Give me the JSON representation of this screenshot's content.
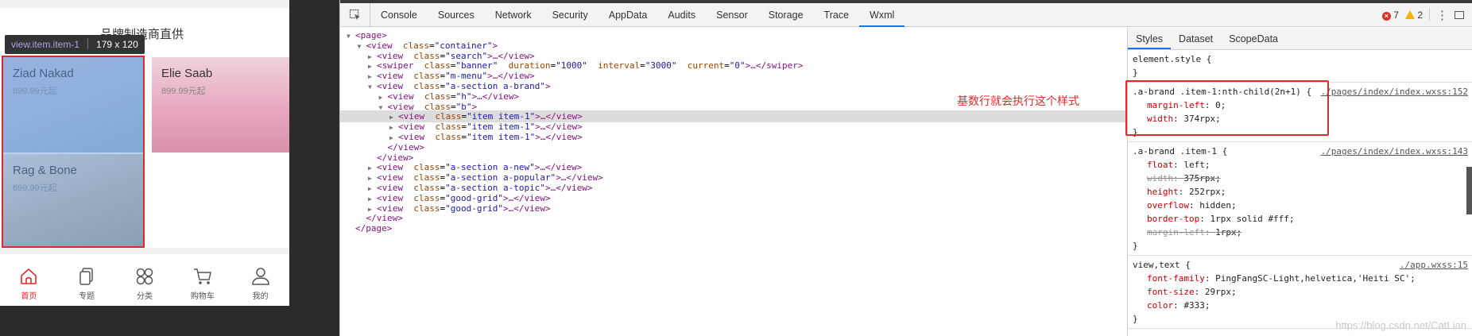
{
  "simulator": {
    "brand_title": "品牌制造商直供",
    "inspect_tooltip": {
      "selector": "view.item.item-1",
      "size": "179 x 120"
    },
    "items": [
      {
        "name": "Ziad Nakad",
        "price": "899.99元起"
      },
      {
        "name": "Elie Saab",
        "price": "899.99元起"
      },
      {
        "name": "Rag & Bone",
        "price": "899.99元起"
      }
    ],
    "tabbar": [
      {
        "label": "首页",
        "icon": "home-icon",
        "active": true
      },
      {
        "label": "专题",
        "icon": "topic-icon",
        "active": false
      },
      {
        "label": "分类",
        "icon": "category-icon",
        "active": false
      },
      {
        "label": "购物车",
        "icon": "cart-icon",
        "active": false
      },
      {
        "label": "我的",
        "icon": "user-icon",
        "active": false
      }
    ]
  },
  "devtools": {
    "tabs": [
      "Console",
      "Sources",
      "Network",
      "Security",
      "AppData",
      "Audits",
      "Sensor",
      "Storage",
      "Trace",
      "Wxml"
    ],
    "active_tab": "Wxml",
    "error_count": "7",
    "warning_count": "2",
    "tree": [
      {
        "indent": 0,
        "arrow": "▼",
        "open": "<page>",
        "attrs": [],
        "tail": ""
      },
      {
        "indent": 1,
        "arrow": "▼",
        "open": "<view",
        "attrs": [
          [
            "class",
            "\"container\""
          ]
        ],
        "tail": ">"
      },
      {
        "indent": 2,
        "arrow": "▶",
        "open": "<view",
        "attrs": [
          [
            "class",
            "\"search\""
          ]
        ],
        "tail": ">…</view>"
      },
      {
        "indent": 2,
        "arrow": "▶",
        "open": "<swiper",
        "attrs": [
          [
            "class",
            "\"banner\""
          ],
          [
            "duration",
            "\"1000\""
          ],
          [
            "interval",
            "\"3000\""
          ],
          [
            "current",
            "\"0\""
          ]
        ],
        "tail": ">…</swiper>"
      },
      {
        "indent": 2,
        "arrow": "▶",
        "open": "<view",
        "attrs": [
          [
            "class",
            "\"m-menu\""
          ]
        ],
        "tail": ">…</view>"
      },
      {
        "indent": 2,
        "arrow": "▼",
        "open": "<view",
        "attrs": [
          [
            "class",
            "\"a-section a-brand\""
          ]
        ],
        "tail": ">"
      },
      {
        "indent": 3,
        "arrow": "▶",
        "open": "<view",
        "attrs": [
          [
            "class",
            "\"h\""
          ]
        ],
        "tail": ">…</view>"
      },
      {
        "indent": 3,
        "arrow": "▼",
        "open": "<view",
        "attrs": [
          [
            "class",
            "\"b\""
          ]
        ],
        "tail": ">"
      },
      {
        "indent": 4,
        "arrow": "▶",
        "open": "<view",
        "attrs": [
          [
            "class",
            "\"item item-1\""
          ]
        ],
        "tail": ">…</view>",
        "selected": true
      },
      {
        "indent": 4,
        "arrow": "▶",
        "open": "<view",
        "attrs": [
          [
            "class",
            "\"item item-1\""
          ]
        ],
        "tail": ">…</view>"
      },
      {
        "indent": 4,
        "arrow": "▶",
        "open": "<view",
        "attrs": [
          [
            "class",
            "\"item item-1\""
          ]
        ],
        "tail": ">…</view>"
      },
      {
        "indent": 3,
        "arrow": "",
        "open": "</view>",
        "attrs": [],
        "tail": ""
      },
      {
        "indent": 2,
        "arrow": "",
        "open": "</view>",
        "attrs": [],
        "tail": ""
      },
      {
        "indent": 2,
        "arrow": "▶",
        "open": "<view",
        "attrs": [
          [
            "class",
            "\"a-section a-new\""
          ]
        ],
        "tail": ">…</view>"
      },
      {
        "indent": 2,
        "arrow": "▶",
        "open": "<view",
        "attrs": [
          [
            "class",
            "\"a-section a-popular\""
          ]
        ],
        "tail": ">…</view>"
      },
      {
        "indent": 2,
        "arrow": "▶",
        "open": "<view",
        "attrs": [
          [
            "class",
            "\"a-section a-topic\""
          ]
        ],
        "tail": ">…</view>"
      },
      {
        "indent": 2,
        "arrow": "▶",
        "open": "<view",
        "attrs": [
          [
            "class",
            "\"good-grid\""
          ]
        ],
        "tail": ">…</view>"
      },
      {
        "indent": 2,
        "arrow": "▶",
        "open": "<view",
        "attrs": [
          [
            "class",
            "\"good-grid\""
          ]
        ],
        "tail": ">…</view>"
      },
      {
        "indent": 1,
        "arrow": "",
        "open": "</view>",
        "attrs": [],
        "tail": ""
      },
      {
        "indent": 0,
        "arrow": "",
        "open": "</page>",
        "attrs": [],
        "tail": ""
      }
    ],
    "annotation": "基数行就会执行这个样式",
    "pane_tabs": [
      "Styles",
      "Dataset",
      "ScopeData"
    ],
    "active_pane_tab": "Styles",
    "rules": [
      {
        "selector": "element.style {",
        "source": "",
        "props": []
      },
      {
        "selector": ".a-brand .item-1:nth-child(2n+1) {",
        "source": "./pages/index/index.wxss:152",
        "props": [
          [
            "margin-left",
            "0;",
            false
          ],
          [
            "width",
            "374rpx;",
            false
          ]
        ]
      },
      {
        "selector": ".a-brand .item-1 {",
        "source": "./pages/index/index.wxss:143",
        "props": [
          [
            "float",
            "left;",
            false
          ],
          [
            "width",
            "375rpx;",
            true
          ],
          [
            "height",
            "252rpx;",
            false
          ],
          [
            "overflow",
            "hidden;",
            false
          ],
          [
            "border-top",
            "1rpx solid #fff;",
            false
          ],
          [
            "margin-left",
            "1rpx;",
            true
          ]
        ]
      },
      {
        "selector": "view,text {",
        "source": "./app.wxss:15",
        "props": [
          [
            "font-family",
            "PingFangSC-Light,helvetica,'Heiti SC';",
            false
          ],
          [
            "font-size",
            "29rpx;",
            false
          ],
          [
            "color",
            "#333;",
            false
          ]
        ]
      }
    ],
    "watermark": "https://blog.csdn.net/CatLian"
  }
}
